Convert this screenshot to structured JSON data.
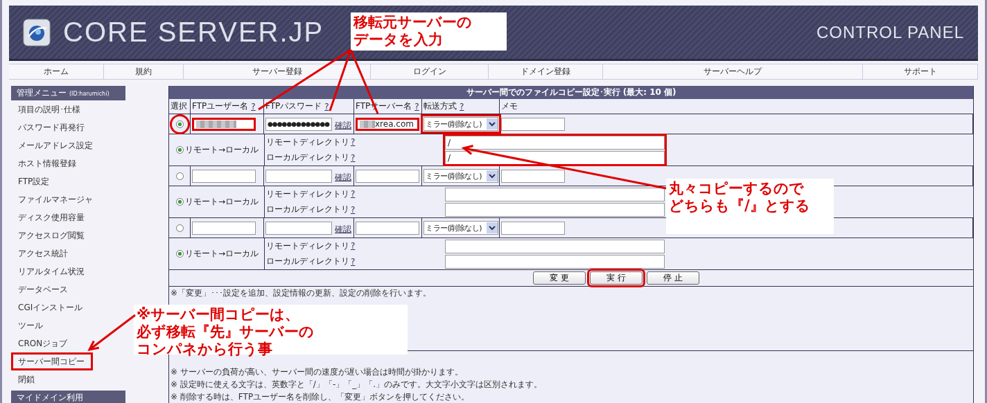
{
  "header": {
    "logo": "CORE SERVER.JP",
    "subtitle": "CONTROL PANEL"
  },
  "nav": [
    {
      "label": "ホーム"
    },
    {
      "label": "規約"
    },
    {
      "label": "サーバー登録"
    },
    {
      "label": "ログイン"
    },
    {
      "label": "ドメイン登録"
    },
    {
      "label": "サーバーヘルプ"
    },
    {
      "label": "サポート"
    }
  ],
  "sidebar": {
    "title": "管理メニュー",
    "account": "(ID:harumichi)",
    "items": [
      {
        "label": "項目の説明･仕様",
        "highlighted": false
      },
      {
        "label": "パスワード再発行",
        "highlighted": false
      },
      {
        "label": "メールアドレス設定",
        "highlighted": false
      },
      {
        "label": "ホスト情報登録",
        "highlighted": false
      },
      {
        "label": "FTP設定",
        "highlighted": false
      },
      {
        "label": "ファイルマネージャ",
        "highlighted": false
      },
      {
        "label": "ディスク使用容量",
        "highlighted": false
      },
      {
        "label": "アクセスログ閲覧",
        "highlighted": false
      },
      {
        "label": "アクセス統計",
        "highlighted": false
      },
      {
        "label": "リアルタイム状況",
        "highlighted": false
      },
      {
        "label": "データベース",
        "highlighted": false
      },
      {
        "label": "CGIインストール",
        "highlighted": false
      },
      {
        "label": "ツール",
        "highlighted": false
      },
      {
        "label": "CRONジョブ",
        "highlighted": false
      },
      {
        "label": "サーバー間コピー",
        "highlighted": true
      },
      {
        "label": "閉鎖",
        "highlighted": false
      }
    ],
    "section": "マイドメイン利用"
  },
  "table": {
    "title": "サーバー間でのファイルコピー設定･実行 (最大: 10 個)",
    "columns": [
      {
        "label": "選択"
      },
      {
        "label": "FTPユーザー名",
        "help": "?"
      },
      {
        "label": "FTPパスワード",
        "help": "?"
      },
      {
        "label": "FTPサーバー名",
        "help": "?"
      },
      {
        "label": "転送方式",
        "help": "?"
      },
      {
        "label": "メモ"
      }
    ],
    "entries": [
      {
        "selected": true,
        "highlighted": true,
        "user_blurred": true,
        "password": "●●●●●●●●●●●●●",
        "confirm": "確認",
        "server_blurred": true,
        "server": "xrea.com",
        "method": "ミラー(削除なし)",
        "direction": {
          "label": "リモート→ローカル",
          "selected": true
        },
        "remote_label": "リモートディレクトリ",
        "local_label": "ローカルディレクトリ",
        "help": "?",
        "remote_dir": "/",
        "local_dir": "/"
      },
      {
        "selected": false,
        "highlighted": false,
        "user_blurred": false,
        "confirm": "確認",
        "server_blurred": false,
        "method": "ミラー(削除なし)",
        "direction": {
          "label": "リモート→ローカル",
          "selected": true
        },
        "remote_label": "リモートディレクトリ",
        "local_label": "ローカルディレクトリ",
        "help": "?"
      },
      {
        "selected": false,
        "highlighted": false,
        "user_blurred": false,
        "confirm": "確認",
        "server_blurred": false,
        "method": "ミラー(削除なし)",
        "direction": {
          "label": "リモート→ローカル",
          "selected": true
        },
        "remote_label": "リモートディレクトリ",
        "local_label": "ローカルディレクトリ",
        "help": "?"
      }
    ],
    "buttons": [
      {
        "label": "変 更",
        "highlighted": false
      },
      {
        "label": "実 行",
        "highlighted": true
      },
      {
        "label": "停 止",
        "highlighted": false
      }
    ],
    "notes_1": [
      "※「変更」･･･設定を追加、設定情報の更新、設定の削除を行います。"
    ],
    "notes_2": [
      "※ サーバーの負荷が高い、サーバー間の速度が遅い場合は時間が掛かります。",
      "※ 設定時に使える文字は、英数字と「/」「-」「_」「.」のみです。大文字小文字は区別されます。",
      "※ 削除する時は、FTPユーザー名を削除し、「変更」ボタンを押してください。"
    ]
  },
  "annotations": [
    {
      "lines": [
        "移転元サーバーの",
        "データを入力"
      ]
    },
    {
      "lines": [
        "丸々コピーするので",
        "どちらも『/』とする"
      ]
    },
    {
      "lines": [
        "※サーバー間コピーは、",
        "必ず移転『先』サーバーの",
        "コンパネから行う事"
      ]
    }
  ]
}
